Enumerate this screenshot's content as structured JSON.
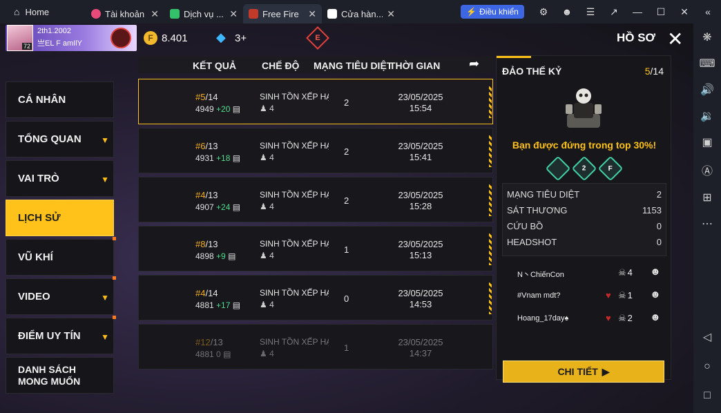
{
  "emulator": {
    "home_label": "Home",
    "tabs": [
      {
        "label": "Tài khoản",
        "icon_color": "#e84a7a"
      },
      {
        "label": "Dịch vụ ...",
        "icon_color": "#34c06a"
      },
      {
        "label": "Free Fire",
        "icon_color": "#c23a2a"
      },
      {
        "label": "Cửa hàn...",
        "icon_color": "#4a8af4"
      }
    ],
    "control_label": "Điều khiển",
    "window_icons": [
      "gamepad-icon",
      "account-icon",
      "menu-icon",
      "popout-icon",
      "minimize-icon",
      "maximize-icon",
      "close-icon",
      "collapse-icon"
    ],
    "rail_icons": [
      "settings-icon",
      "keyboard-icon",
      "volume-up-icon",
      "volume-down-icon",
      "screenshot-icon",
      "macro-icon",
      "add-window-icon",
      "more-icon",
      "back-icon",
      "home-icon",
      "recent-icon"
    ]
  },
  "player": {
    "name": "2th1.2002",
    "guild": "亗EL F amIlY",
    "level": "72"
  },
  "currency": {
    "coins": "8.401",
    "diamonds": "3+"
  },
  "header": {
    "title": "HỒ SƠ"
  },
  "sidebar": {
    "items": [
      {
        "label": "CÁ NHÂN"
      },
      {
        "label": "TỔNG QUAN"
      },
      {
        "label": "VAI TRÒ"
      },
      {
        "label": "LỊCH SỬ"
      },
      {
        "label": "VŨ KHÍ"
      },
      {
        "label": "VIDEO"
      },
      {
        "label": "ĐIỂM UY TÍN"
      },
      {
        "label": "DANH SÁCH MONG MUỐN"
      }
    ]
  },
  "history": {
    "columns": [
      "KẾT QUẢ",
      "CHẾ ĐỘ",
      "MẠNG TIÊU DIỆT",
      "THỜI GIAN"
    ],
    "rows": [
      {
        "rank": "#5",
        "total": "/14",
        "score": "4949",
        "delta": "+20",
        "mode": "SINH TỒN XẾP HẠ",
        "party": "4",
        "kills": "2",
        "date": "23/05/2025",
        "time": "15:54"
      },
      {
        "rank": "#6",
        "total": "/13",
        "score": "4931",
        "delta": "+18",
        "mode": "SINH TỒN XẾP HẠ",
        "party": "4",
        "kills": "2",
        "date": "23/05/2025",
        "time": "15:41"
      },
      {
        "rank": "#4",
        "total": "/13",
        "score": "4907",
        "delta": "+24",
        "mode": "SINH TỒN XẾP HẠ",
        "party": "4",
        "kills": "2",
        "date": "23/05/2025",
        "time": "15:28"
      },
      {
        "rank": "#8",
        "total": "/13",
        "score": "4898",
        "delta": "+9",
        "mode": "SINH TỒN XẾP HẠ",
        "party": "4",
        "kills": "1",
        "date": "23/05/2025",
        "time": "15:13"
      },
      {
        "rank": "#4",
        "total": "/14",
        "score": "4881",
        "delta": "+17",
        "mode": "SINH TỒN XẾP HẠ",
        "party": "4",
        "kills": "0",
        "date": "23/05/2025",
        "time": "14:53"
      },
      {
        "rank": "#12",
        "total": "/13",
        "score": "4881",
        "delta": "0",
        "mode": "SINH TỒN XẾP HẠ",
        "party": "4",
        "kills": "1",
        "date": "23/05/2025",
        "time": "14:37"
      }
    ]
  },
  "detail": {
    "map": "ĐẢO THẾ KỶ",
    "count_current": "5",
    "count_total": "/14",
    "message": "Bạn được đứng trong top 30%!",
    "badge_labels": [
      "",
      "2",
      "F"
    ],
    "stats": [
      {
        "label": "MẠNG TIÊU DIỆT",
        "value": "2"
      },
      {
        "label": "SÁT THƯƠNG",
        "value": "1153"
      },
      {
        "label": "CỨU BỒ",
        "value": "0"
      },
      {
        "label": "HEADSHOT",
        "value": "0"
      }
    ],
    "players": [
      {
        "name": "N丶ChiếnCon",
        "kills": "4"
      },
      {
        "name": "#Vnam     mdt?",
        "kills": "1"
      },
      {
        "name": "Hoang_17day♠",
        "kills": "2"
      }
    ],
    "button_label": "CHI TIẾT"
  }
}
